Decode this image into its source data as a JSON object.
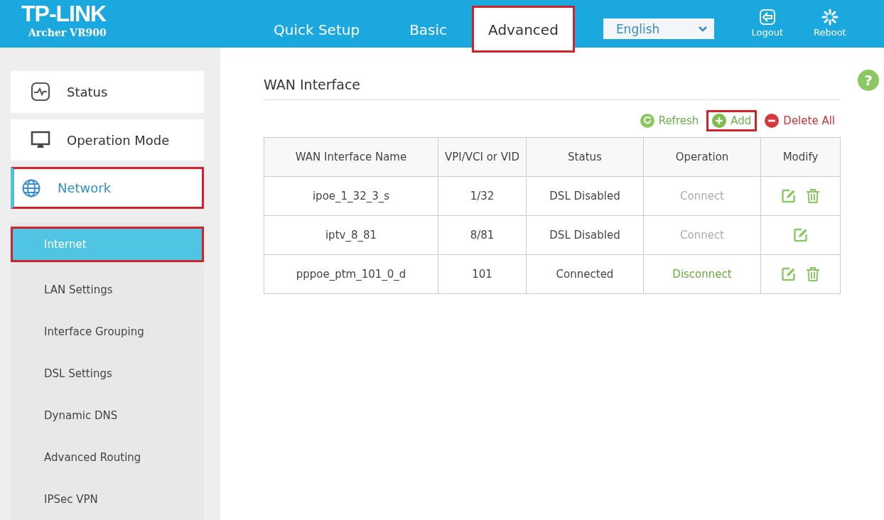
{
  "brand": {
    "logo": "TP-LINK",
    "model": "Archer VR900"
  },
  "tabs": [
    {
      "label": "Quick Setup",
      "selected": false,
      "highlighted": false
    },
    {
      "label": "Basic",
      "selected": false,
      "highlighted": false
    },
    {
      "label": "Advanced",
      "selected": true,
      "highlighted": true
    }
  ],
  "language": {
    "value": "English"
  },
  "header_actions": [
    {
      "kind": "logout",
      "label": "Logout"
    },
    {
      "kind": "reboot",
      "label": "Reboot"
    }
  ],
  "sidebar": {
    "items": [
      {
        "kind": "status",
        "label": "Status",
        "selected": false,
        "highlighted": false
      },
      {
        "kind": "mode",
        "label": "Operation Mode",
        "selected": false,
        "highlighted": false
      },
      {
        "kind": "network",
        "label": "Network",
        "selected": true,
        "highlighted": true
      }
    ],
    "subitems": [
      {
        "label": "Internet",
        "selected": true,
        "highlighted": true
      },
      {
        "label": "LAN Settings",
        "selected": false,
        "highlighted": false
      },
      {
        "label": "Interface Grouping",
        "selected": false,
        "highlighted": false
      },
      {
        "label": "DSL Settings",
        "selected": false,
        "highlighted": false
      },
      {
        "label": "Dynamic DNS",
        "selected": false,
        "highlighted": false
      },
      {
        "label": "Advanced Routing",
        "selected": false,
        "highlighted": false
      },
      {
        "label": "IPSec VPN",
        "selected": false,
        "highlighted": false
      }
    ]
  },
  "section_title": "WAN Interface",
  "help": "?",
  "toolbar": [
    {
      "kind": "refresh",
      "label": "Refresh",
      "highlighted": false
    },
    {
      "kind": "add",
      "label": "Add",
      "highlighted": true
    },
    {
      "kind": "delete",
      "label": "Delete All",
      "highlighted": false
    }
  ],
  "table": {
    "columns": [
      "WAN Interface Name",
      "VPI/VCI or VID",
      "Status",
      "Operation",
      "Modify"
    ],
    "rows": [
      {
        "name": "ipoe_1_32_3_s",
        "vid": "1/32",
        "status": "DSL Disabled",
        "operation": "Connect",
        "disabled": true,
        "deletable": true
      },
      {
        "name": "iptv_8_81",
        "vid": "8/81",
        "status": "DSL Disabled",
        "operation": "Connect",
        "disabled": true,
        "deletable": false
      },
      {
        "name": "pppoe_ptm_101_0_d",
        "vid": "101",
        "status": "Connected",
        "operation": "Disconnect",
        "disabled": false,
        "deletable": true
      }
    ]
  }
}
